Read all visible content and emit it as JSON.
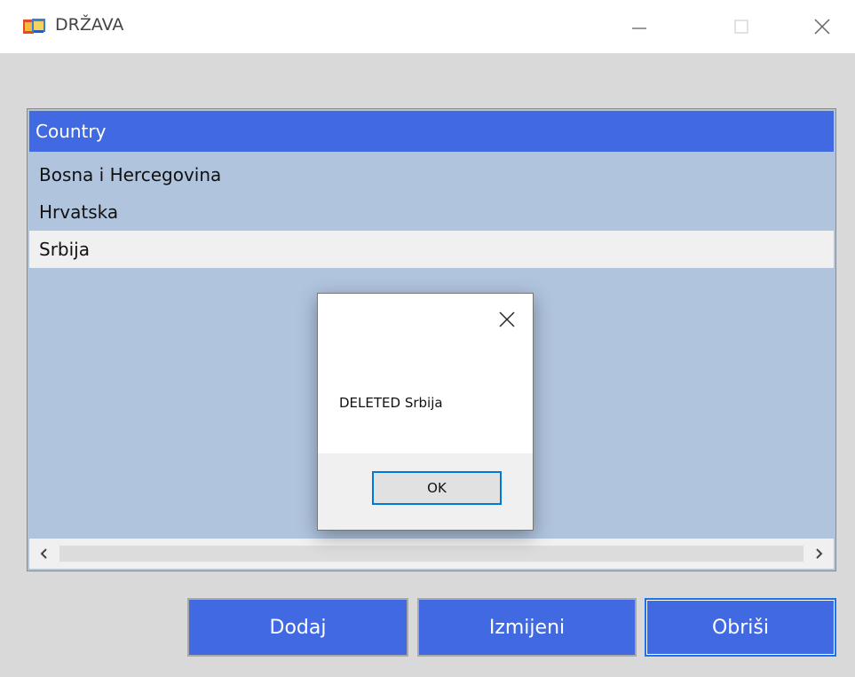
{
  "window": {
    "title": "DRŽAVA",
    "app_icon": "winforms-app-icon",
    "controls": [
      "minimize-icon",
      "maximize-icon",
      "close-icon"
    ]
  },
  "list": {
    "header": "Country",
    "rows": [
      "Bosna i Hercegovina",
      "Hrvatska",
      "Srbija"
    ],
    "selected_index": 2,
    "scroll_left": "‹",
    "scroll_right": "›"
  },
  "buttons": {
    "add_label": "Dodaj",
    "edit_label": "Izmijeni",
    "delete_label": "Obriši"
  },
  "message_box": {
    "text": "DELETED Srbija",
    "ok_label": "OK"
  },
  "colors": {
    "header_bg": "#4169e1",
    "list_bg": "#b0c4de",
    "button_bg": "#4169e1",
    "client_bg": "#d9d9d9"
  }
}
